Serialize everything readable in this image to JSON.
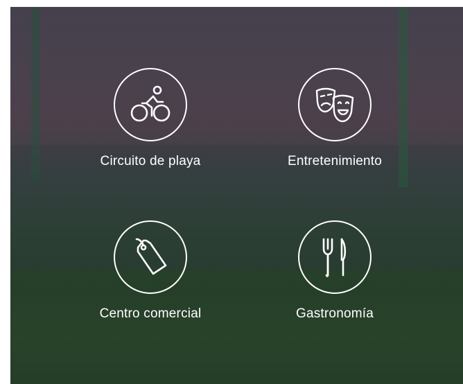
{
  "colors": {
    "overlay": "#1e2a36",
    "text": "#ffffff",
    "icon_stroke": "#ffffff"
  },
  "categories": [
    {
      "label": "Circuito de playa",
      "icon": "cyclist-icon"
    },
    {
      "label": "Entretenimiento",
      "icon": "theater-masks-icon"
    },
    {
      "label": "Centro comercial",
      "icon": "price-tag-icon"
    },
    {
      "label": "Gastronomía",
      "icon": "fork-knife-icon"
    }
  ]
}
